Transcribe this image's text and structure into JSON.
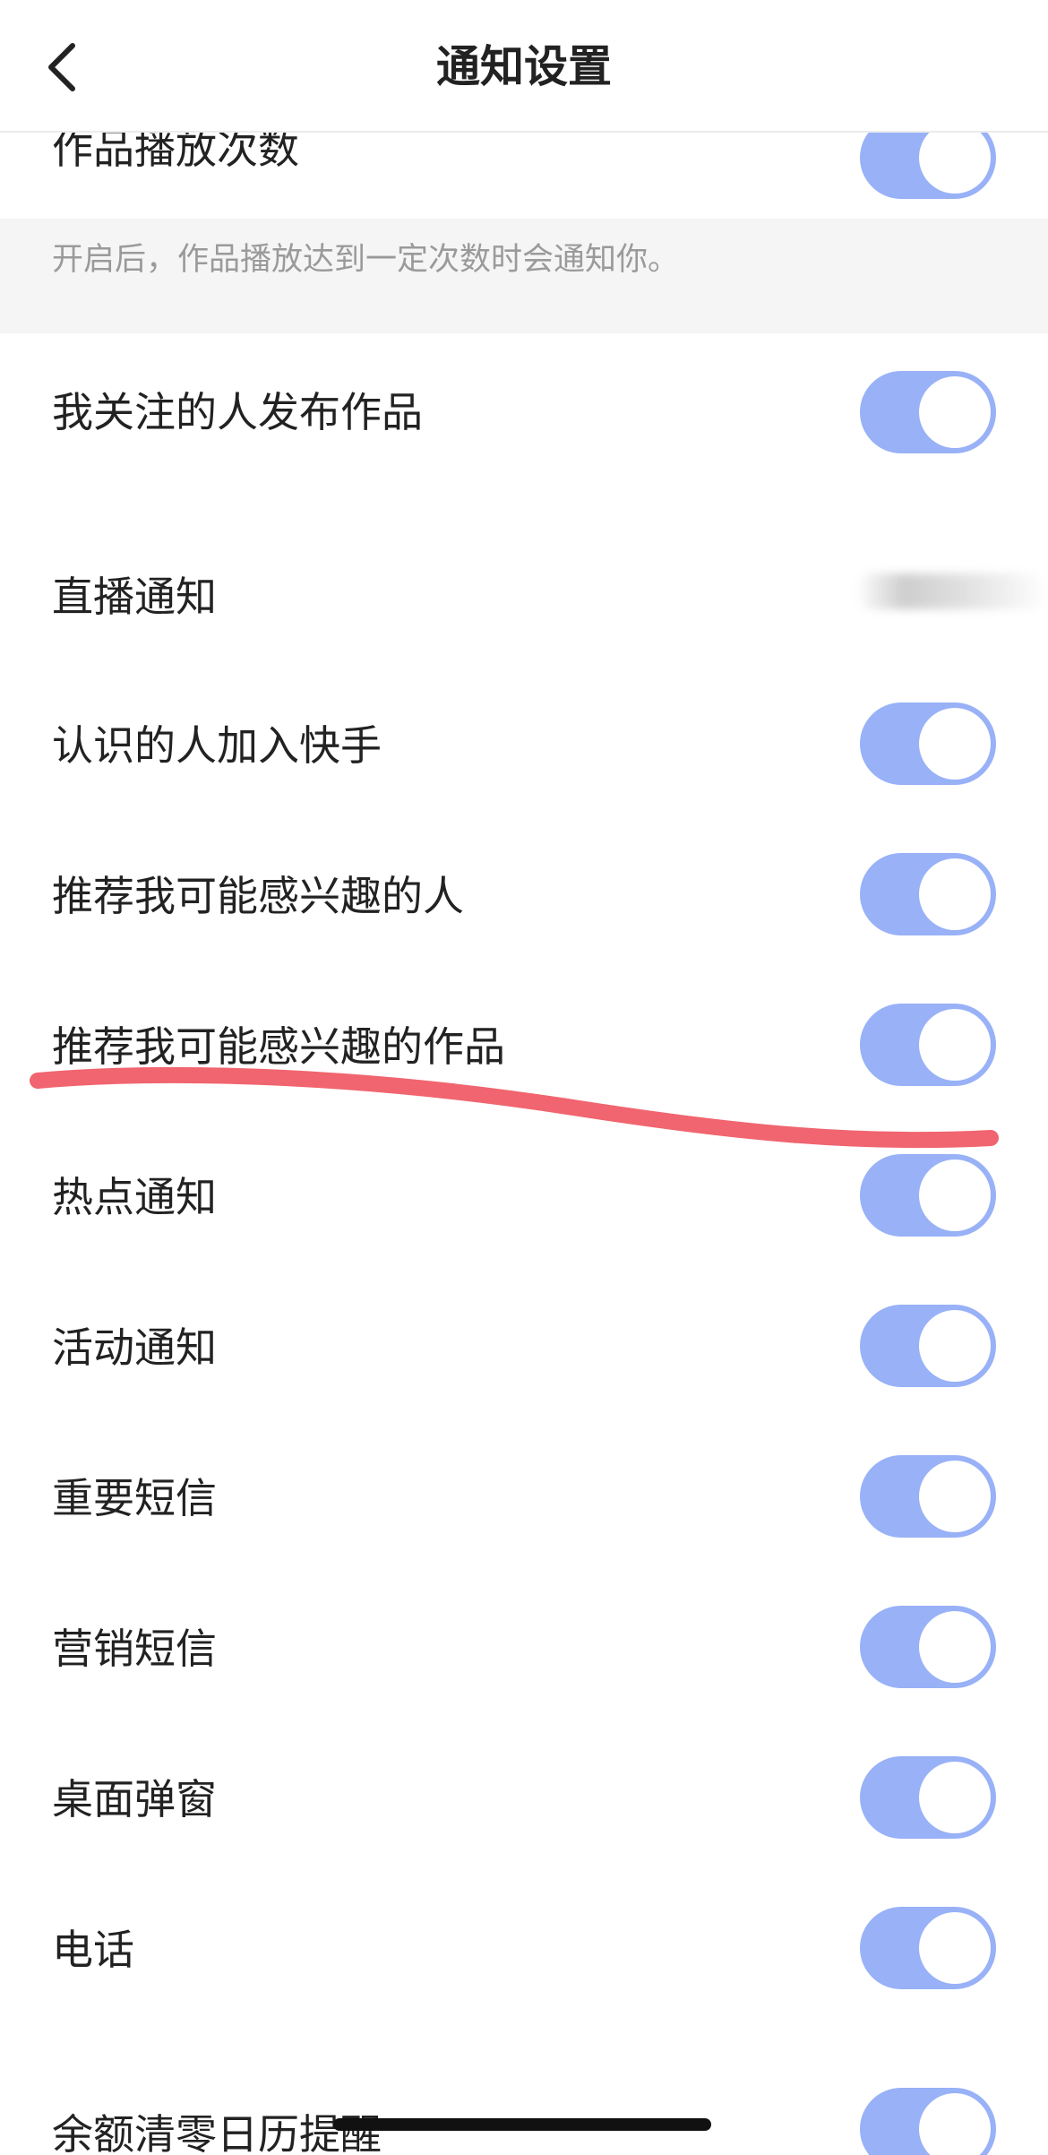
{
  "header": {
    "title": "通知设置",
    "back_icon": "chevron-left-icon"
  },
  "settings": {
    "play_count": {
      "label": "作品播放次数",
      "enabled": true
    },
    "play_count_description": "开启后，作品播放达到一定次数时会通知你。",
    "followed_publish": {
      "label": "我关注的人发布作品",
      "enabled": true
    },
    "live": {
      "label": "直播通知"
    },
    "friends_join": {
      "label": "认识的人加入快手",
      "enabled": true
    },
    "recommend_people": {
      "label": "推荐我可能感兴趣的人",
      "enabled": true
    },
    "recommend_works": {
      "label": "推荐我可能感兴趣的作品",
      "enabled": true
    },
    "hot": {
      "label": "热点通知",
      "enabled": true
    },
    "activity": {
      "label": "活动通知",
      "enabled": true
    },
    "important_sms": {
      "label": "重要短信",
      "enabled": true
    },
    "marketing_sms": {
      "label": "营销短信",
      "enabled": true
    },
    "desktop_popup": {
      "label": "桌面弹窗",
      "enabled": true
    },
    "phone": {
      "label": "电话",
      "enabled": true
    },
    "balance_reminder": {
      "label": "余额清零日历提醒",
      "enabled": true
    }
  },
  "colors": {
    "toggle_on": "#98b1f7",
    "annotation_line": "#f0656f",
    "section_bg": "#f5f5f5"
  }
}
